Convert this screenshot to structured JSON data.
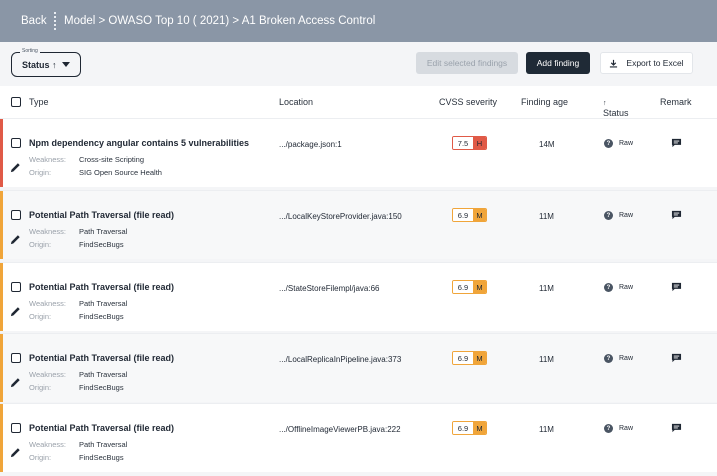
{
  "nav": {
    "back_label": "Back",
    "breadcrumb": "Model > OWASO Top 10 ( 2021) > A1 Broken Access Control"
  },
  "toolbar": {
    "sorting_label": "Sorting",
    "sorting_value": "Status",
    "sorting_arrow": "↑",
    "edit_label": "Edit selected findings",
    "add_label": "Add finding",
    "export_label": "Export to Excel"
  },
  "columns": {
    "type": "Type",
    "location": "Location",
    "cvss": "CVSS severity",
    "age": "Finding age",
    "status": "Status",
    "status_arrow": "↑",
    "remark": "Remark"
  },
  "labels": {
    "weakness": "Weakness:",
    "origin": "Origin:"
  },
  "colors": {
    "high": "#e05a47",
    "high_bar": "#e05a47",
    "medium": "#f0a53a",
    "medium_bar": "#f0a53a"
  },
  "findings": [
    {
      "title": "Npm dependency angular contains 5 vulnerabilities",
      "weakness": "Cross-site Scripting",
      "origin": "SIG Open Source Health",
      "location": ".../package.json:1",
      "score": "7.5",
      "severity": "H",
      "severity_level": "high",
      "age": "14M",
      "status": "Raw",
      "status_icon": "question-icon",
      "remark_icon": "comment-icon"
    },
    {
      "title": "Potential Path Traversal (file read)",
      "weakness": "Path Traversal",
      "origin": "FindSecBugs",
      "location": ".../LocalKeyStoreProvider.java:150",
      "score": "6.9",
      "severity": "M",
      "severity_level": "medium",
      "age": "11M",
      "status": "Raw",
      "status_icon": "question-icon",
      "remark_icon": "comment-icon"
    },
    {
      "title": "Potential Path Traversal (file read)",
      "weakness": "Path Traversal",
      "origin": "FindSecBugs",
      "location": ".../StateStoreFilempl/java:66",
      "score": "6.9",
      "severity": "M",
      "severity_level": "medium",
      "age": "11M",
      "status": "Raw",
      "status_icon": "question-icon",
      "remark_icon": "comment-icon"
    },
    {
      "title": "Potential Path Traversal (file read)",
      "weakness": "Path Traversal",
      "origin": "FindSecBugs",
      "location": ".../LocalReplicaInPipeline.java:373",
      "score": "6.9",
      "severity": "M",
      "severity_level": "medium",
      "age": "11M",
      "status": "Raw",
      "status_icon": "question-icon",
      "remark_icon": "comment-icon"
    },
    {
      "title": "Potential Path Traversal (file read)",
      "weakness": "Path Traversal",
      "origin": "FindSecBugs",
      "location": ".../OfflineImageViewerPB.java:222",
      "score": "6.9",
      "severity": "M",
      "severity_level": "medium",
      "age": "11M",
      "status": "Raw",
      "status_icon": "question-icon",
      "remark_icon": "comment-icon"
    }
  ]
}
